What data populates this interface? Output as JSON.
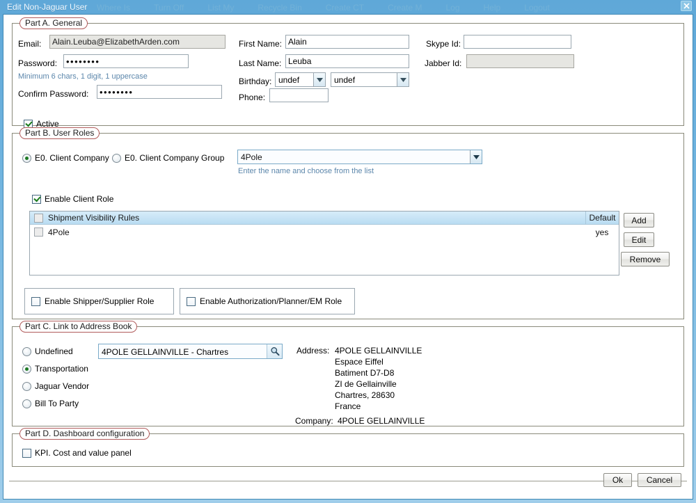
{
  "window": {
    "title": "Edit Non-Jaguar User",
    "close_icon": "close-icon",
    "ghost_menu": [
      "Where Is",
      "Turn Off",
      "List My",
      "Recycle Bin",
      "Create CT",
      "Create M",
      "Log",
      "Help",
      "Logout"
    ]
  },
  "partA": {
    "legend": "Part A. General",
    "email_label": "Email:",
    "email_value": "Alain.Leuba@ElizabethArden.com",
    "password_label": "Password:",
    "password_value": "••••••••",
    "password_hint": "Minimum 6 chars, 1 digit, 1 uppercase",
    "confirm_label": "Confirm Password:",
    "confirm_value": "••••••••",
    "active_label": "Active",
    "first_name_label": "First Name:",
    "first_name_value": "Alain",
    "last_name_label": "Last Name:",
    "last_name_value": "Leuba",
    "birthday_label": "Birthday:",
    "birthday_day": "undef",
    "birthday_month": "undef",
    "phone_label": "Phone:",
    "phone_value": "",
    "skype_label": "Skype Id:",
    "skype_value": "",
    "jabber_label": "Jabber Id:",
    "jabber_value": ""
  },
  "partB": {
    "legend": "Part B. User Roles",
    "radio_company": "E0. Client Company",
    "radio_company_group": "E0. Client Company Group",
    "company_value": "4Pole",
    "company_hint": "Enter the name and choose from the list",
    "enable_client_role": "Enable Client Role",
    "table": {
      "header_col1": "Shipment Visibility Rules",
      "header_col2": "Default",
      "rows": [
        {
          "name": "4Pole",
          "default": "yes"
        }
      ]
    },
    "buttons": {
      "add": "Add",
      "edit": "Edit",
      "remove": "Remove"
    },
    "enable_shipper": "Enable Shipper/Supplier Role",
    "enable_authorization": "Enable Authorization/Planner/EM Role"
  },
  "partC": {
    "legend": "Part C. Link to Address Book",
    "radios": [
      "Undefined",
      "Transportation",
      "Jaguar Vendor",
      "Bill To Party"
    ],
    "selected_radio": "Transportation",
    "search_value": "4POLE GELLAINVILLE - Chartres",
    "search_icon": "magnifier-icon",
    "address_label": "Address:",
    "address_lines": [
      "4POLE GELLAINVILLE",
      "Espace Eiffel",
      "Batiment D7-D8",
      "ZI de Gellainville",
      "Chartres, 28630",
      "France"
    ],
    "company_label": "Company:",
    "company_value": "4POLE GELLAINVILLE"
  },
  "partD": {
    "legend": "Part D. Dashboard configuration",
    "kpi_label": "KPI. Cost and value panel"
  },
  "footer": {
    "ok": "Ok",
    "cancel": "Cancel"
  }
}
